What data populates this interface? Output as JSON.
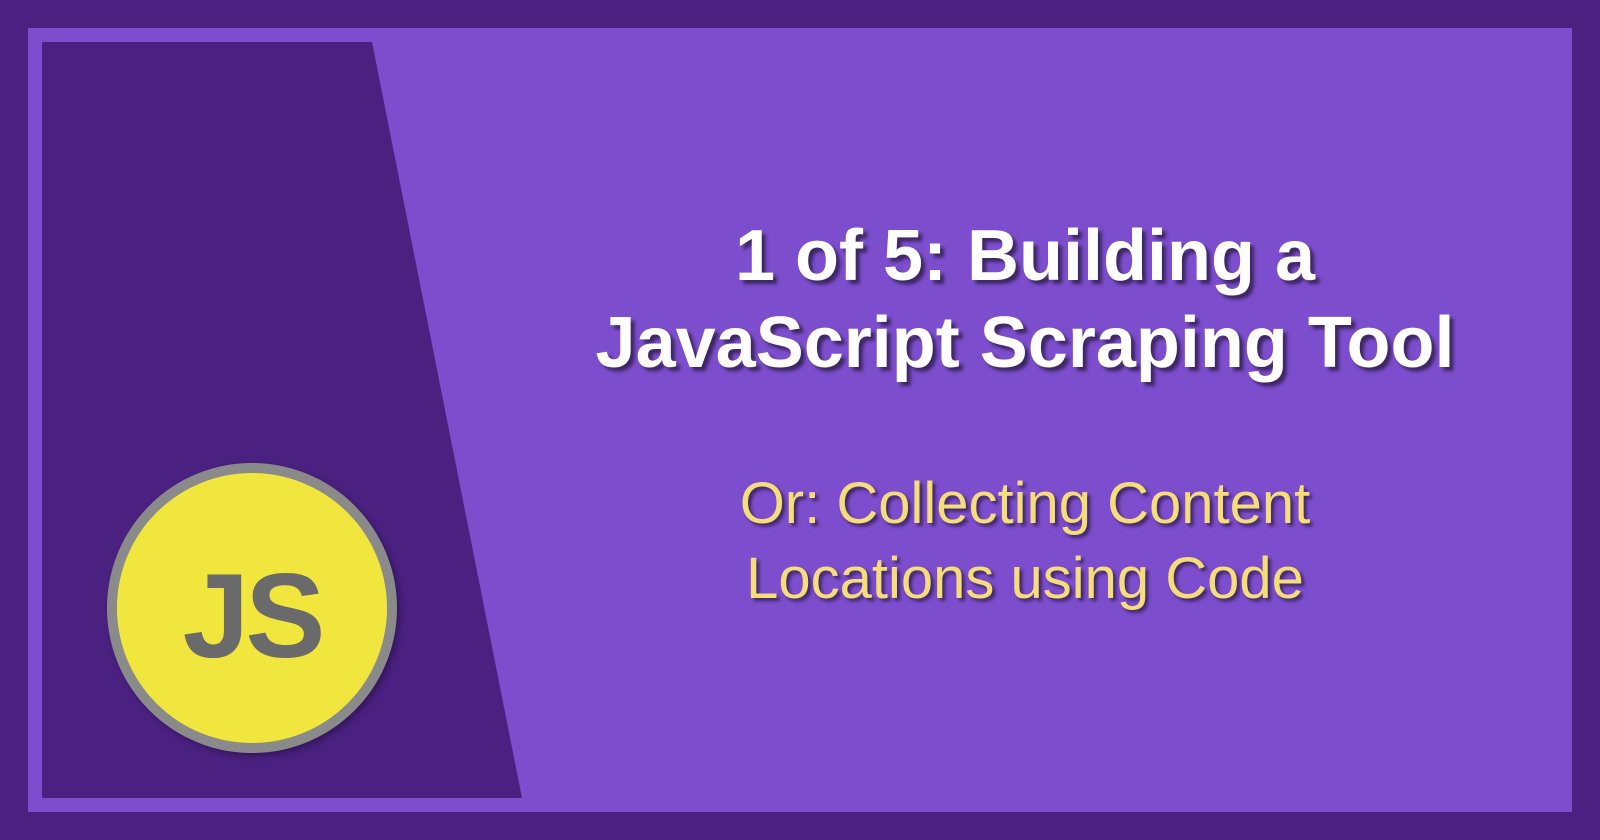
{
  "slide": {
    "badge_text": "JS",
    "title_line1": "1 of 5: Building a",
    "title_line2": "JavaScript Scraping Tool",
    "subtitle_line1": "Or: Collecting Content",
    "subtitle_line2": "Locations using Code"
  },
  "colors": {
    "outer_frame": "#4a2080",
    "inner_bg": "#7c4dcc",
    "badge_bg": "#f0e63e",
    "badge_border": "#8a8a8a",
    "title_color": "#ffffff",
    "subtitle_color": "#f5dd7a"
  }
}
